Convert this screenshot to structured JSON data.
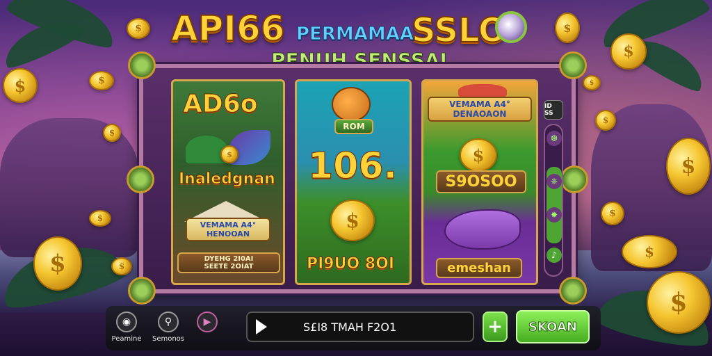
{
  "title": {
    "main": "API66",
    "permainan": "PERMAMAA",
    "slot": "SSLO",
    "subtitle": "PENUH SENSSAI"
  },
  "panels": {
    "p1": {
      "logo": "AD6o",
      "game_title": "Inaledgnan",
      "badge": "VEMAMA A4° HENOOAN",
      "footer_line1": "DYEHG 2I0AI",
      "footer_line2": "SEETE 2OIAT"
    },
    "p2": {
      "badge": "ROM",
      "big_number": "106.",
      "footer": "PI9UO 8OI"
    },
    "p3": {
      "badge": "VEMAMA A4° DENAOAON",
      "amount": "S9OSOO",
      "footer": "emeshan"
    }
  },
  "side_controls": {
    "top": "ID SS",
    "btn1": "❆",
    "btn2": "❈",
    "btn3": "✸",
    "btn4": "♪"
  },
  "bottom_bar": {
    "tools": [
      {
        "label": "Peamine",
        "icon": "slot-machine-icon"
      },
      {
        "label": "Semonos",
        "icon": "chat-search-icon"
      },
      {
        "label": "",
        "icon": "play-circle-icon"
      }
    ],
    "play_text": "S£I8 TMAH F2O1",
    "plus_label": "+",
    "action_label": "SKOAN"
  },
  "colors": {
    "gold": "#ffd23a",
    "green_button": "#46ad22",
    "frame_border": "#b57aa3"
  }
}
